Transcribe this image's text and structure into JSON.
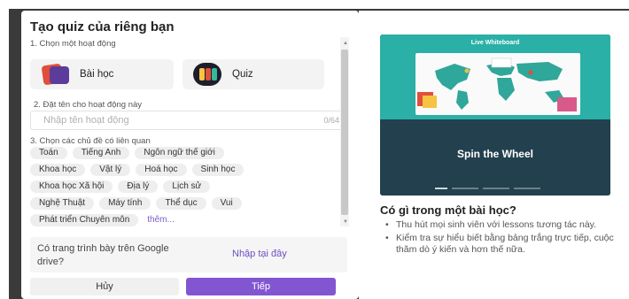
{
  "panel_title": "Tạo quiz của riêng bạn",
  "step1": {
    "label": "1. Chọn một hoạt động",
    "options": [
      {
        "label": "Bài học",
        "icon": "lesson-book-icon"
      },
      {
        "label": "Quiz",
        "icon": "quiz-icon"
      }
    ]
  },
  "step2": {
    "label": "2. Đặt tên cho hoạt động này",
    "placeholder": "Nhập tên hoạt động",
    "counter": "0/64"
  },
  "step3": {
    "label": "3. Chọn các chủ đề có liên quan",
    "rows": [
      [
        "Toán",
        "Tiếng Anh",
        "Ngôn ngữ thế giới"
      ],
      [
        "Khoa học",
        "Vật lý",
        "Hoá học",
        "Sinh học"
      ],
      [
        "Khoa học Xã hội",
        "Địa lý",
        "Lịch sử"
      ],
      [
        "Nghệ Thuật",
        "Máy tính",
        "Thể dục",
        "Vui"
      ],
      [
        "Phát triển Chuyên môn"
      ]
    ],
    "more": "thêm..."
  },
  "gdrive": {
    "question": "Có trang trình bày trên Google drive?",
    "link": "Nhập tại đây"
  },
  "buttons": {
    "cancel": "Hủy",
    "next": "Tiếp"
  },
  "preview": {
    "top_label": "Live Whiteboard",
    "caption": "Spin the Wheel",
    "slides": 4,
    "active_slide": 0
  },
  "info": {
    "title": "Có gì trong một bài học?",
    "points": [
      "Thu hút mọi sinh viên với lessons tương tác này.",
      "Kiểm tra sự hiểu biết bằng bảng trắng trực tiếp, cuộc thăm dò ý kiến và hơn thế nữa."
    ]
  },
  "colors": {
    "accent": "#8256d0",
    "link": "#6a4fc0",
    "teal": "#2ab0a6",
    "preview_dark": "#23404e"
  }
}
